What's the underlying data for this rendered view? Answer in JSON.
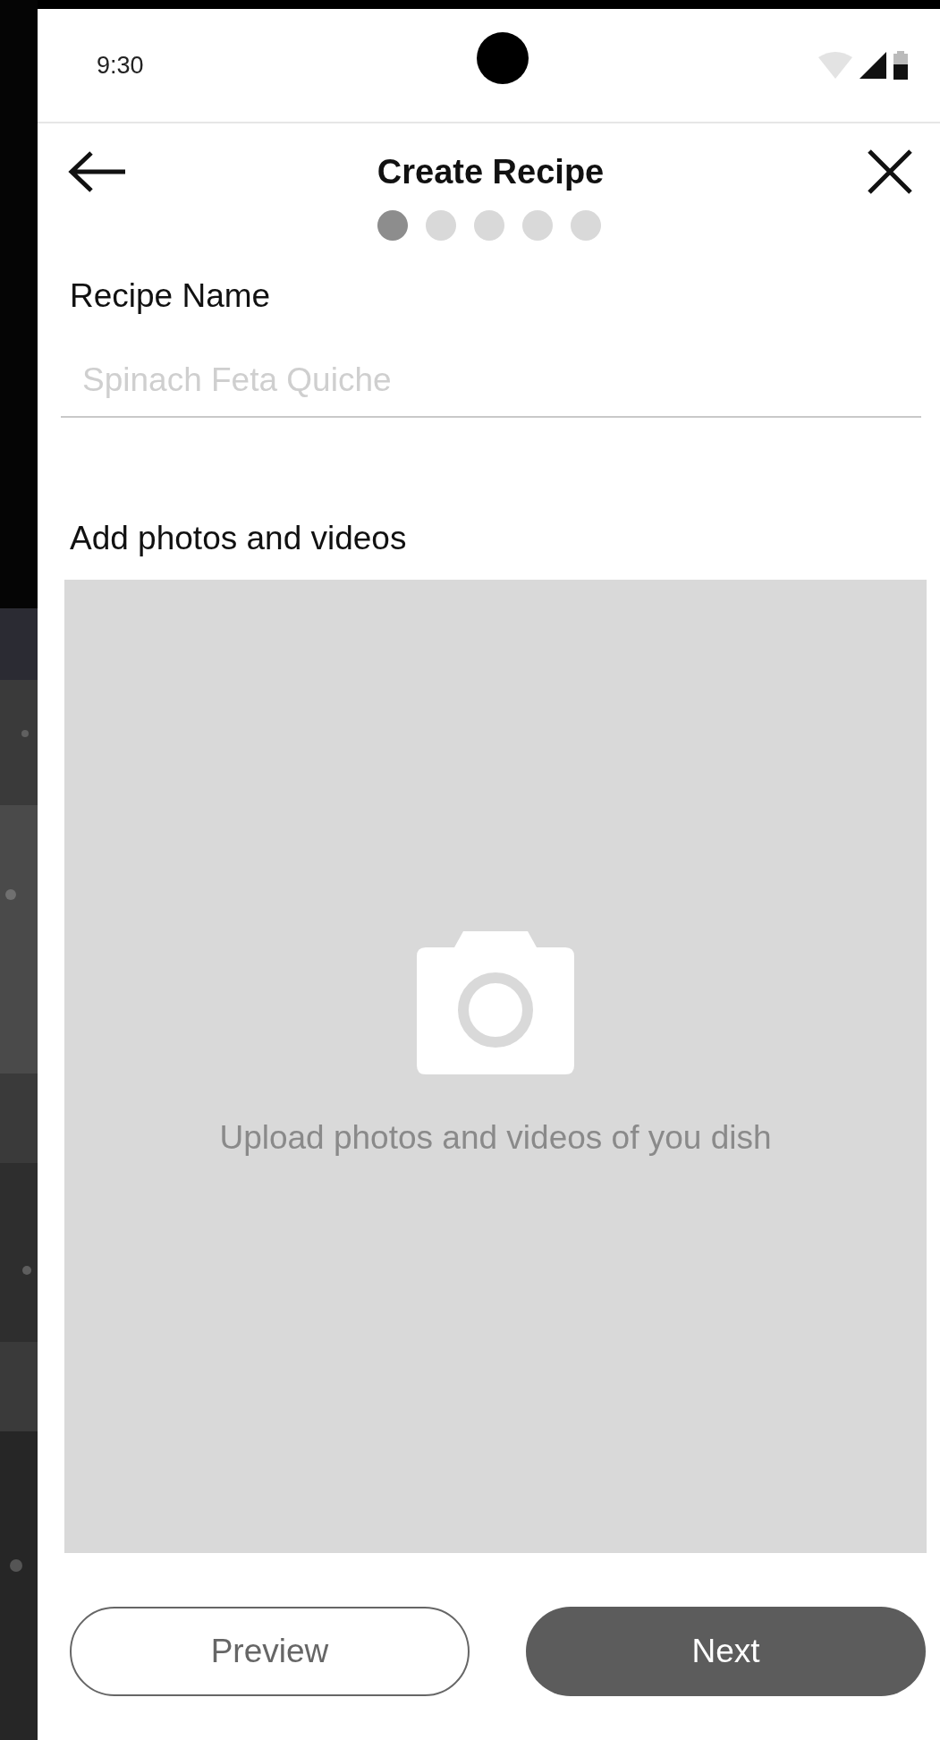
{
  "status_bar": {
    "time": "9:30"
  },
  "header": {
    "title": "Create Recipe"
  },
  "steps": [
    {
      "selected": true
    },
    {
      "selected": false
    },
    {
      "selected": false
    },
    {
      "selected": false
    },
    {
      "selected": false
    }
  ],
  "recipe_name": {
    "label": "Recipe Name",
    "placeholder": "Spinach Feta Quiche"
  },
  "media": {
    "label": "Add photos and videos",
    "hint": "Upload photos and videos of you dish"
  },
  "buttons": [
    {
      "label": "Preview",
      "kind": "outline"
    },
    {
      "label": "Next",
      "kind": "filled"
    }
  ]
}
